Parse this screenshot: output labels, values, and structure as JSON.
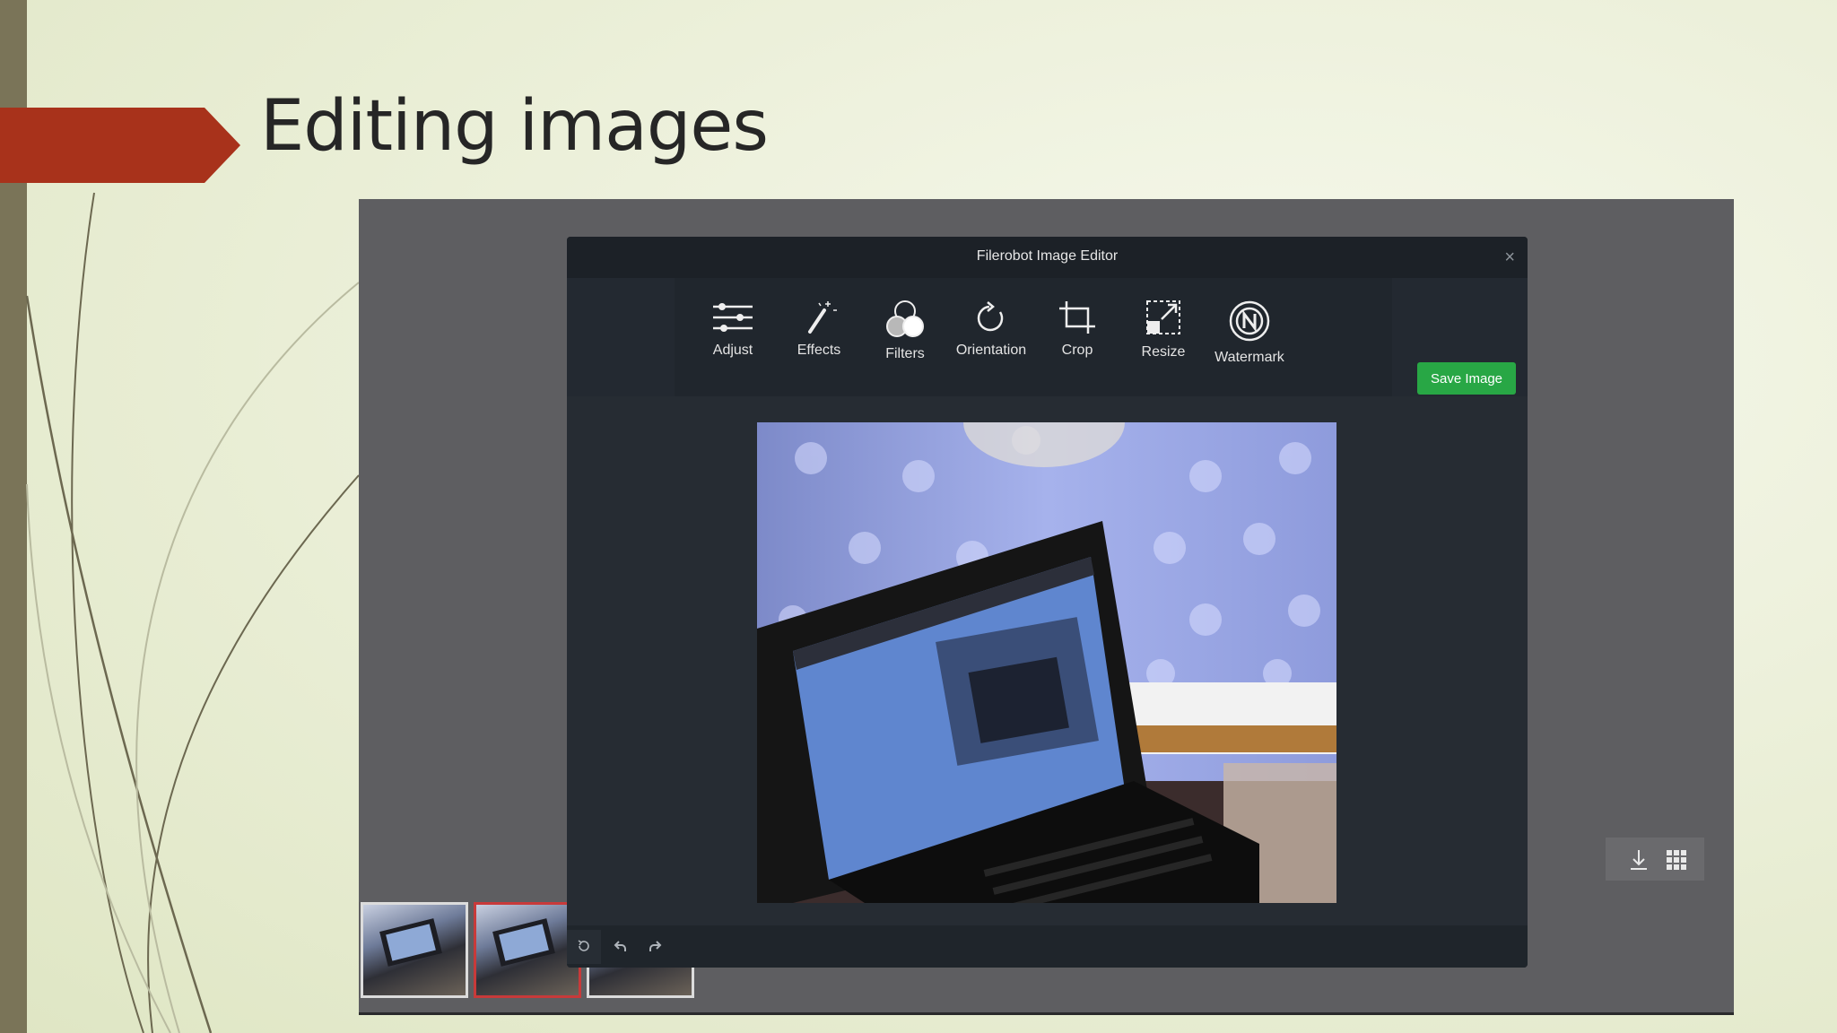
{
  "slide": {
    "title": "Editing images"
  },
  "editor": {
    "window_title": "Filerobot Image Editor",
    "close_glyph": "×",
    "tools": [
      {
        "label": "Adjust",
        "icon": "sliders-icon"
      },
      {
        "label": "Effects",
        "icon": "magic-wand-icon"
      },
      {
        "label": "Filters",
        "icon": "filter-circles-icon"
      },
      {
        "label": "Orientation",
        "icon": "rotate-icon"
      },
      {
        "label": "Crop",
        "icon": "crop-icon"
      },
      {
        "label": "Resize",
        "icon": "resize-icon"
      },
      {
        "label": "Watermark",
        "icon": "watermark-icon"
      }
    ],
    "save_label": "Save Image",
    "history_buttons": [
      "reset-icon",
      "undo-icon",
      "redo-icon"
    ]
  },
  "background_app": {
    "thumbnails": 3,
    "selected_thumbnail": 2,
    "controls": [
      "download-icon",
      "grid-icon"
    ]
  },
  "colors": {
    "accent_arrow": "#a8321b",
    "save_button": "#28a745",
    "editor_bg": "#262c33",
    "selected_thumb_border": "#c83a3a"
  }
}
